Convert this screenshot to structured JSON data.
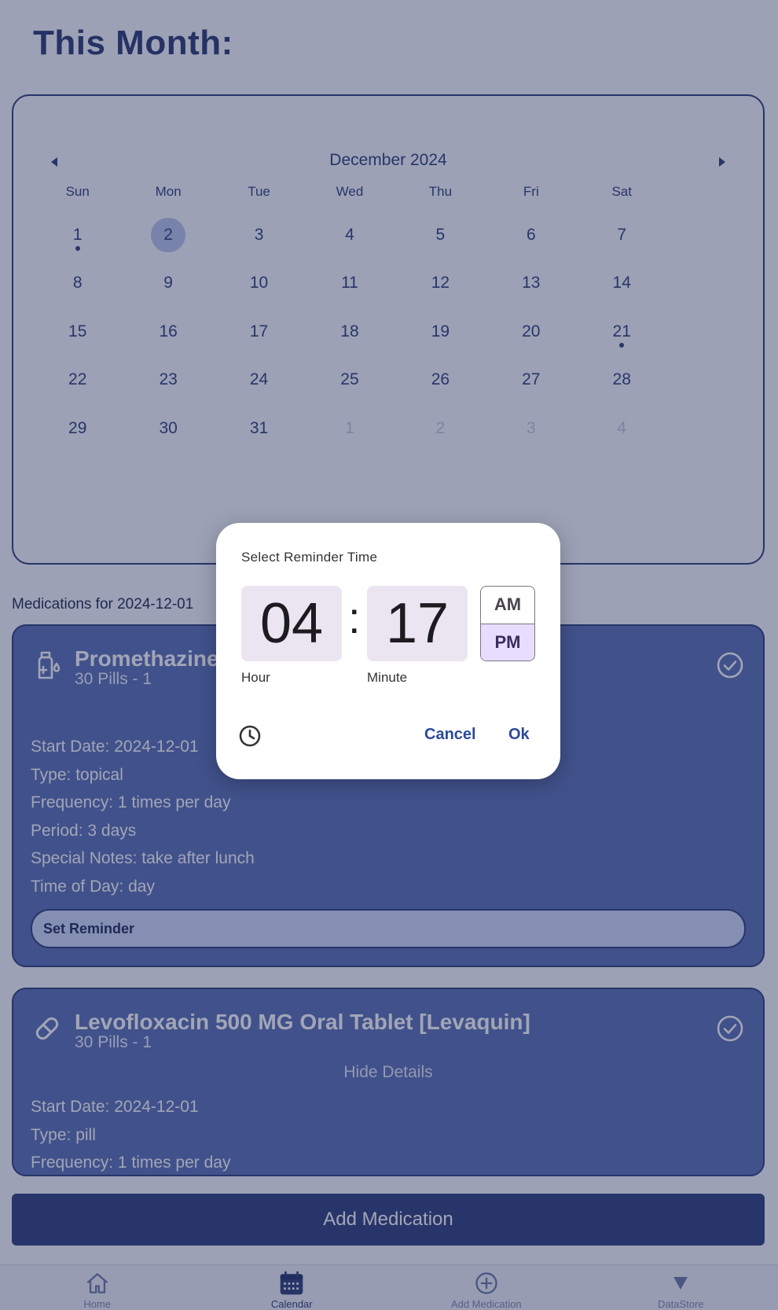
{
  "page": {
    "title": "This Month:"
  },
  "calendar": {
    "month_label": "December 2024",
    "weekdays": [
      "Sun",
      "Mon",
      "Tue",
      "Wed",
      "Thu",
      "Fri",
      "Sat"
    ],
    "weeks": [
      [
        {
          "d": "1",
          "dot": true
        },
        {
          "d": "2",
          "selected": true
        },
        {
          "d": "3"
        },
        {
          "d": "4"
        },
        {
          "d": "5"
        },
        {
          "d": "6"
        },
        {
          "d": "7"
        }
      ],
      [
        {
          "d": "8"
        },
        {
          "d": "9"
        },
        {
          "d": "10"
        },
        {
          "d": "11"
        },
        {
          "d": "12"
        },
        {
          "d": "13"
        },
        {
          "d": "14"
        }
      ],
      [
        {
          "d": "15"
        },
        {
          "d": "16"
        },
        {
          "d": "17"
        },
        {
          "d": "18"
        },
        {
          "d": "19"
        },
        {
          "d": "20"
        },
        {
          "d": "21",
          "dot": true
        }
      ],
      [
        {
          "d": "22"
        },
        {
          "d": "23"
        },
        {
          "d": "24"
        },
        {
          "d": "25"
        },
        {
          "d": "26"
        },
        {
          "d": "27"
        },
        {
          "d": "28"
        }
      ],
      [
        {
          "d": "29"
        },
        {
          "d": "30"
        },
        {
          "d": "31"
        },
        {
          "d": "1",
          "muted": true
        },
        {
          "d": "2",
          "muted": true
        },
        {
          "d": "3",
          "muted": true
        },
        {
          "d": "4",
          "muted": true
        }
      ]
    ]
  },
  "medications": {
    "section_label": "Medications for 2024-12-01",
    "items": [
      {
        "name": "Promethazine",
        "quantity": "30 Pills - 1",
        "icon": "dropper-bottle-icon",
        "details": [
          "Start Date: 2024-12-01",
          "Type: topical",
          "Frequency: 1 times per day",
          "Period: 3 days",
          "Special Notes: take after lunch",
          "Time of Day: day"
        ],
        "reminder_label": "Set Reminder"
      },
      {
        "name": "Levofloxacin 500 MG Oral Tablet [Levaquin]",
        "quantity": "30 Pills - 1",
        "icon": "pill-icon",
        "toggle_label": "Hide Details",
        "details": [
          "Start Date: 2024-12-01",
          "Type: pill",
          "Frequency: 1 times per day"
        ]
      }
    ]
  },
  "add_button_label": "Add Medication",
  "nav": [
    {
      "label": "Home",
      "icon": "home-icon"
    },
    {
      "label": "Calendar",
      "icon": "calendar-icon",
      "active": true
    },
    {
      "label": "Add Medication",
      "icon": "plus-circle-icon"
    },
    {
      "label": "DataStore",
      "icon": "triangle-down-icon"
    }
  ],
  "time_picker": {
    "title": "Select Reminder Time",
    "hour": "04",
    "minute": "17",
    "hour_label": "Hour",
    "minute_label": "Minute",
    "colon": ":",
    "am": "AM",
    "pm": "PM",
    "selected_period": "PM",
    "cancel": "Cancel",
    "ok": "Ok"
  },
  "colors": {
    "primary": "#2e3f7a",
    "card_bg": "#5a6fb5",
    "selected_day": "#b8c4ec",
    "pm_selected": "#e9ddff"
  }
}
